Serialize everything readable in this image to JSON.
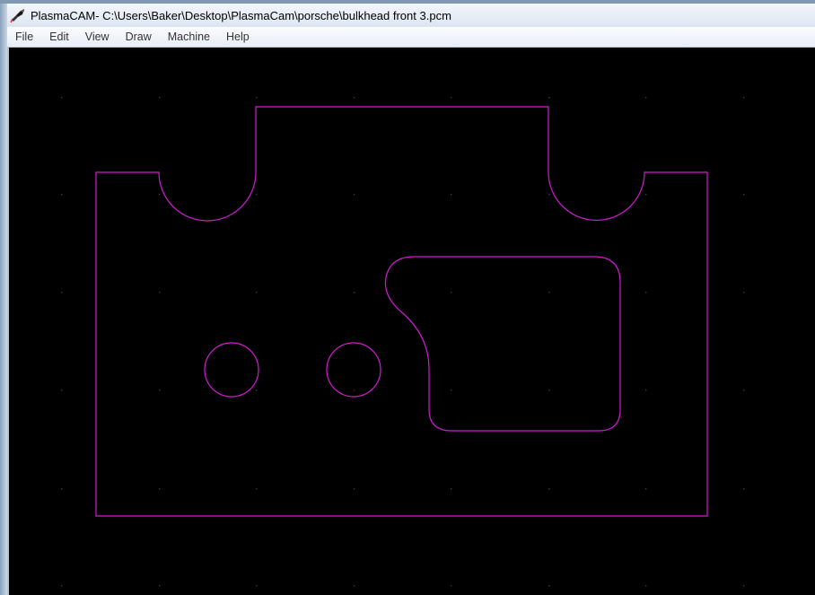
{
  "window": {
    "title": "PlasmaCAM- C:\\Users\\Baker\\Desktop\\PlasmaCam\\porsche\\bulkhead front 3.pcm",
    "app_icon": "plasmacam-torch-icon"
  },
  "menu": {
    "items": [
      {
        "label": "File"
      },
      {
        "label": "Edit"
      },
      {
        "label": "View"
      },
      {
        "label": "Draw"
      },
      {
        "label": "Machine"
      },
      {
        "label": "Help"
      }
    ]
  },
  "canvas": {
    "background": "#000000",
    "line_color": "#d21bd2",
    "grid_dot_color": "#3a3a3a",
    "grid": "dotted"
  }
}
